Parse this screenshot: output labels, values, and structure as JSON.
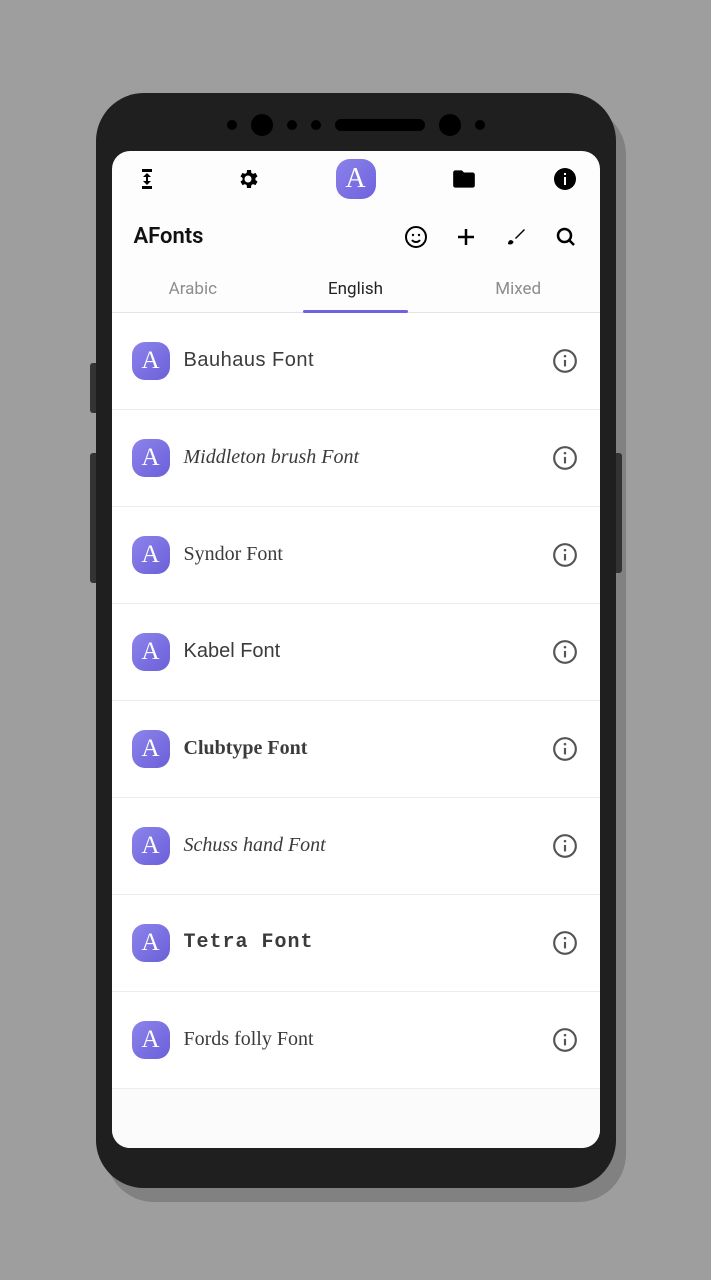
{
  "app_title": "AFonts",
  "tabs": [
    {
      "label": "Arabic",
      "active": false
    },
    {
      "label": "English",
      "active": true
    },
    {
      "label": "Mixed",
      "active": false
    }
  ],
  "fonts": [
    {
      "name": "Bauhaus Font",
      "style_class": "f0"
    },
    {
      "name": "Middleton brush Font",
      "style_class": "f1"
    },
    {
      "name": "Syndor Font",
      "style_class": "f2"
    },
    {
      "name": "Kabel Font",
      "style_class": "f3"
    },
    {
      "name": "Clubtype Font",
      "style_class": "f4"
    },
    {
      "name": "Schuss hand Font",
      "style_class": "f5"
    },
    {
      "name": "Tetra Font",
      "style_class": "f6"
    },
    {
      "name": "Fords folly Font",
      "style_class": "f7"
    }
  ],
  "logo_letter": "A",
  "badge_letter": "A"
}
